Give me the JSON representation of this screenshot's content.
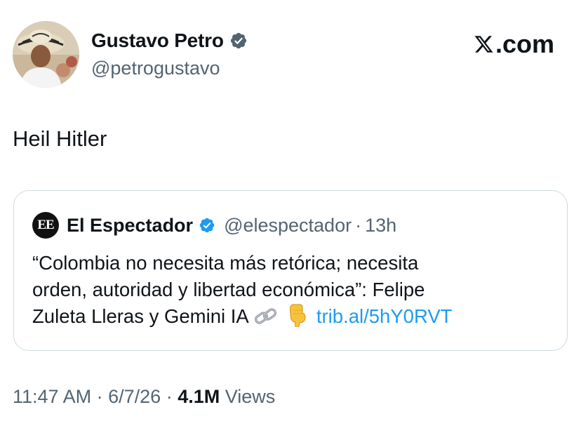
{
  "post": {
    "author": {
      "name": "Gustavo Petro",
      "handle": "@petrogustavo",
      "verified": true
    },
    "brand": {
      "text": ".com",
      "icon": "x-logo-icon"
    },
    "text": "Heil Hitler",
    "quoted": {
      "logo_text": "EE",
      "name": "El Espectador",
      "handle": "@elespectador",
      "separator": "·",
      "time": "13h",
      "lines": [
        "“Colombia no necesita más retórica; necesita",
        "orden, autoridad y libertad económica”: Felipe",
        "Zuleta Lleras y Gemini IA"
      ],
      "emojis": [
        "link-icon",
        "pointing-down-icon"
      ],
      "link": "trib.al/5hY0RVT"
    },
    "meta": {
      "time": "11:47 AM",
      "sep1": "·",
      "date": "6/7/26",
      "sep2": "·",
      "views_count": "4.1M",
      "views_label": "Views"
    }
  },
  "colors": {
    "text": "#0f1419",
    "secondary": "#536471",
    "link": "#1d9bf0",
    "verified": "#1d9bf0",
    "border": "#cfd9de"
  }
}
